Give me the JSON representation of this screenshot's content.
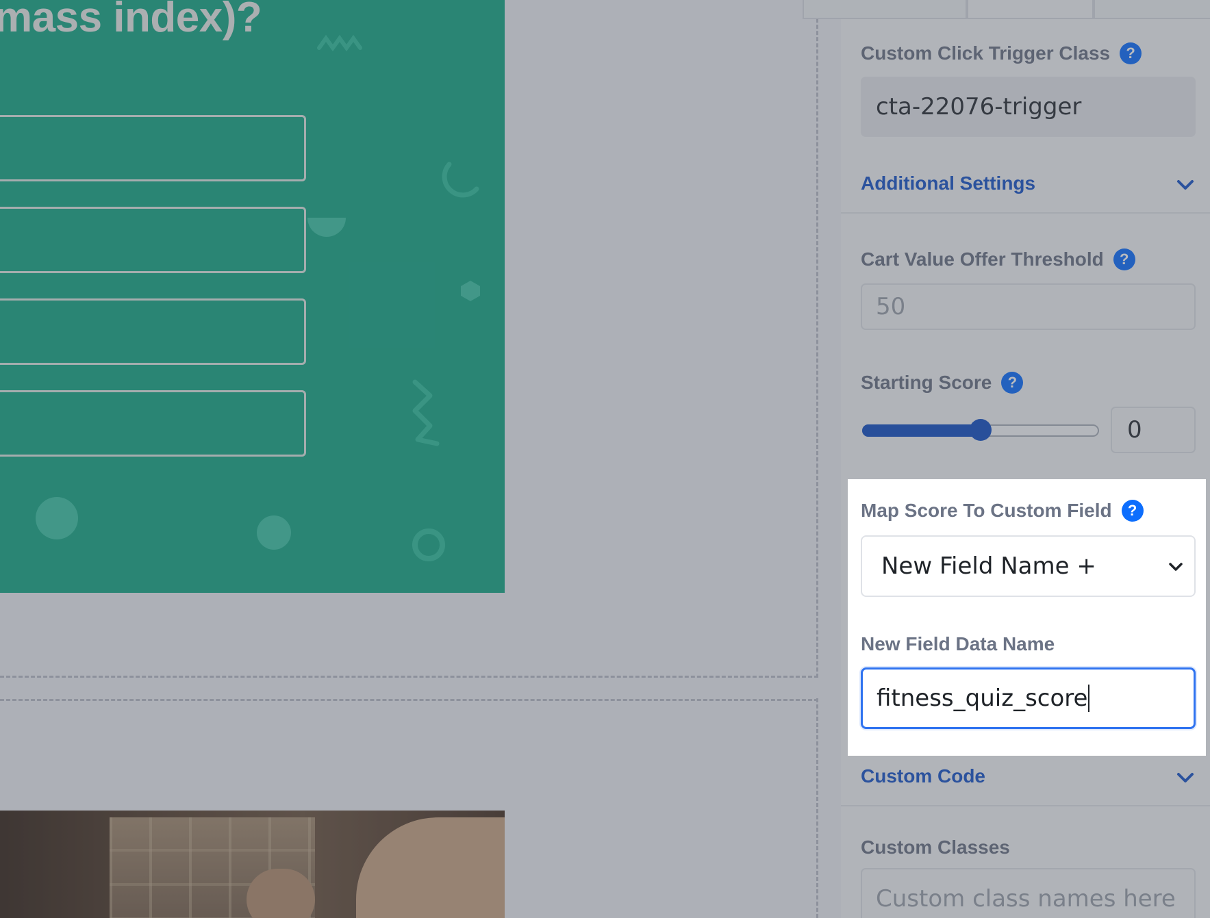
{
  "canvas": {
    "quiz_question": "mass index)?",
    "answer_boxes": 4
  },
  "panel": {
    "custom_click_trigger": {
      "label": "Custom Click Trigger Class",
      "value": "cta-22076-trigger"
    },
    "additional_settings": {
      "title": "Additional Settings"
    },
    "cart_value_threshold": {
      "label": "Cart Value Offer Threshold",
      "value": "50"
    },
    "starting_score": {
      "label": "Starting Score",
      "value": "0",
      "slider_fraction": 0.5
    },
    "map_score": {
      "label": "Map Score To Custom Field",
      "selected": "New Field Name +"
    },
    "new_field_data_name": {
      "label": "New Field Data Name",
      "value": "fitness_quiz_score"
    },
    "custom_code": {
      "title": "Custom Code"
    },
    "custom_classes": {
      "label": "Custom Classes",
      "placeholder": "Custom class names here"
    },
    "help_glyph": "?"
  },
  "colors": {
    "accent": "#0d6efd",
    "section_title": "#1a56c8",
    "quiz_bg": "#19a887",
    "focus_border": "#2f73f0"
  },
  "icons": [
    "help-icon",
    "chevron-down-icon"
  ]
}
